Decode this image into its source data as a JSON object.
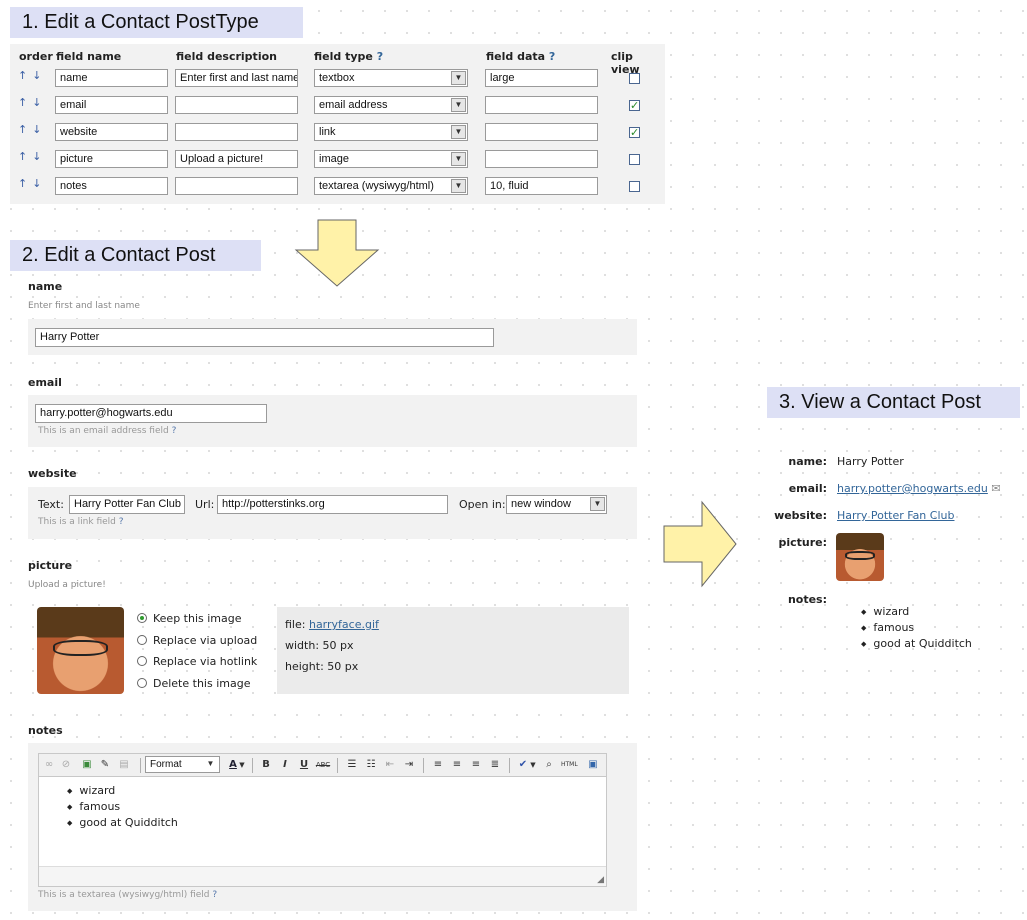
{
  "step1": {
    "title": "1. Edit a Contact PostType",
    "headers": {
      "order": "order",
      "field_name": "field name",
      "field_description": "field description",
      "field_type": "field type",
      "field_type_help": "?",
      "field_data": "field data",
      "field_data_help": "?",
      "clip_view": "clip view"
    },
    "order_arrows": "↑↓",
    "rows": [
      {
        "name": "name",
        "description": "Enter first and last name",
        "type": "textbox",
        "data": "large",
        "clip": false
      },
      {
        "name": "email",
        "description": "",
        "type": "email address",
        "data": "",
        "clip": true
      },
      {
        "name": "website",
        "description": "",
        "type": "link",
        "data": "",
        "clip": true
      },
      {
        "name": "picture",
        "description": "Upload a picture!",
        "type": "image",
        "data": "",
        "clip": false
      },
      {
        "name": "notes",
        "description": "",
        "type": "textarea (wysiwyg/html)",
        "data": "10, fluid",
        "clip": false
      }
    ],
    "dropdown_glyph": "▼"
  },
  "step2": {
    "title": "2. Edit a Contact Post",
    "name": {
      "label": "name",
      "description": "Enter first and last name",
      "value": "Harry Potter"
    },
    "email": {
      "label": "email",
      "value": "harry.potter@hogwarts.edu",
      "hint": "This is an email address field",
      "help": "?"
    },
    "website": {
      "label": "website",
      "text_label": "Text:",
      "text_value": "Harry Potter Fan Club",
      "url_label": "Url:",
      "url_value": "http://potterstinks.org",
      "open_label": "Open in:",
      "open_value": "new window",
      "hint": "This is a link field",
      "help": "?"
    },
    "picture": {
      "label": "picture",
      "description": "Upload a picture!",
      "options": [
        {
          "label": "Keep this image",
          "selected": true
        },
        {
          "label": "Replace via upload",
          "selected": false
        },
        {
          "label": "Replace via hotlink",
          "selected": false
        },
        {
          "label": "Delete this image",
          "selected": false
        }
      ],
      "file_label": "file:",
      "file_value": "harryface.gif",
      "width_label": "width:",
      "width_value": "50 px",
      "height_label": "height:",
      "height_value": "50 px"
    },
    "notes": {
      "label": "notes",
      "format_value": "Format",
      "items": [
        "wizard",
        "famous",
        "good at Quidditch"
      ],
      "hint": "This is a textarea (wysiwyg/html) field",
      "help": "?"
    }
  },
  "step3": {
    "title": "3. View a Contact Post",
    "name_label": "name:",
    "name_value": "Harry Potter",
    "email_label": "email:",
    "email_value": "harry.potter@hogwarts.edu",
    "website_label": "website:",
    "website_value": "Harry Potter Fan Club",
    "picture_label": "picture:",
    "notes_label": "notes:",
    "notes_items": [
      "wizard",
      "famous",
      "good at Quidditch"
    ]
  },
  "colors": {
    "title_bg": "#dde0f5",
    "panel_bg": "#f2f2f2",
    "link": "#336699",
    "arrow_fill": "#fff2a8",
    "check": "#2a8a2a"
  }
}
